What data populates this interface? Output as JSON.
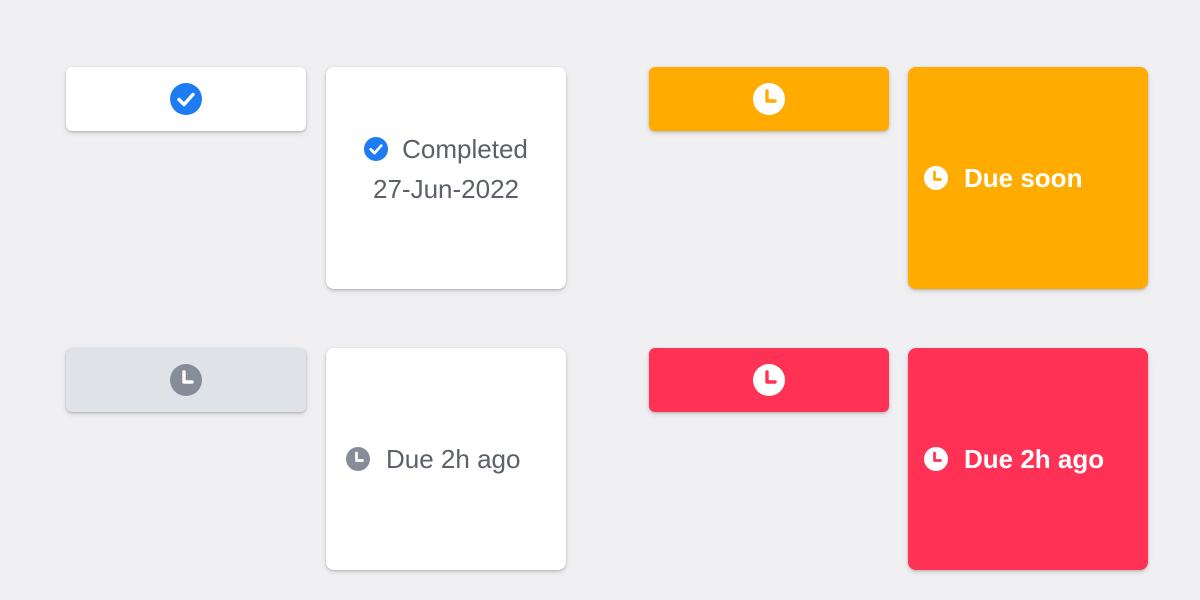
{
  "colors": {
    "background": "#f0f0f2",
    "card_white": "#ffffff",
    "card_grey": "#dfe3e8",
    "accent_blue": "#1e7cf2",
    "warning_orange": "#ffab00",
    "danger_red": "#ff3155",
    "icon_grey": "#868d99",
    "text_grey": "#5c6068"
  },
  "completed_tile": {
    "icon": "check-circle-icon",
    "status": "Completed",
    "date": "27-Jun-2022"
  },
  "due_soon_tile": {
    "icon": "clock-icon",
    "label": "Due soon"
  },
  "overdue_tile": {
    "icon": "clock-icon",
    "label": "Due 2h ago"
  },
  "overdue_critical_tile": {
    "icon": "clock-icon",
    "label": "Due 2h ago"
  },
  "bars": [
    {
      "variant": "completed",
      "icon": "check-circle-icon"
    },
    {
      "variant": "due-soon",
      "icon": "clock-icon"
    },
    {
      "variant": "overdue-neutral",
      "icon": "clock-icon"
    },
    {
      "variant": "overdue-critical",
      "icon": "clock-icon"
    }
  ]
}
